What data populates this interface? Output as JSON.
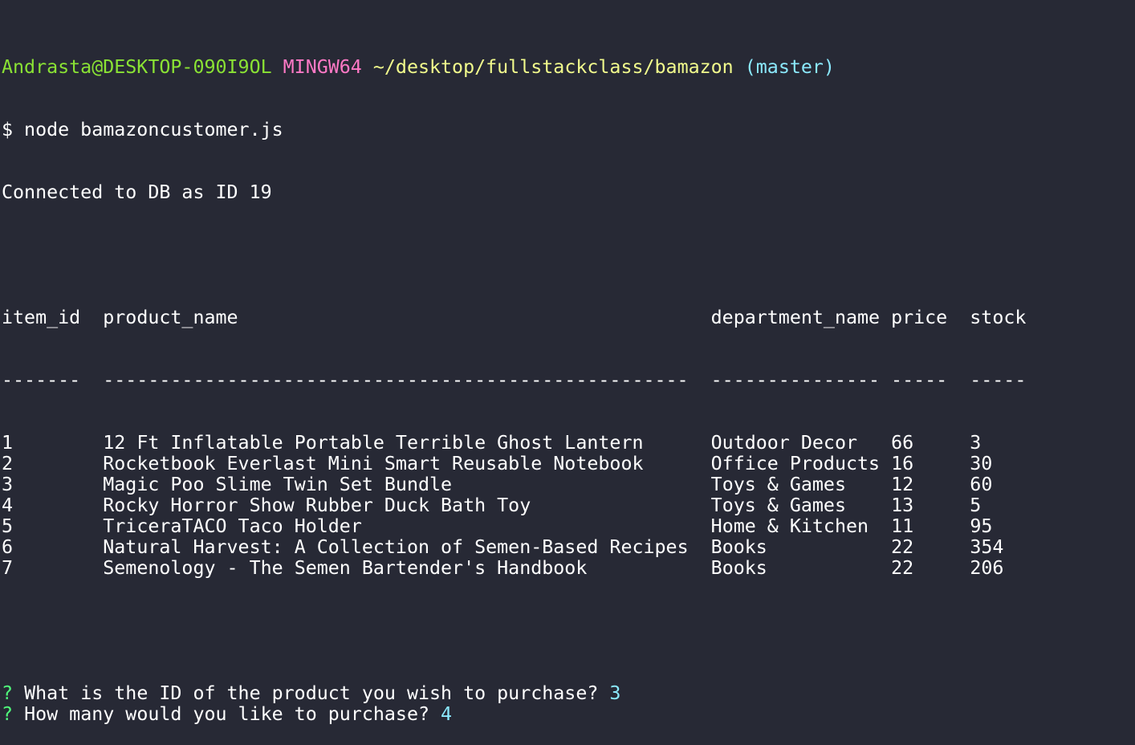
{
  "prompt": {
    "user_host": "Andrasta@DESKTOP-090I9OL",
    "system": "MINGW64",
    "path": "~/desktop/fullstackclass/bamazon",
    "branch": "(master)"
  },
  "command_line": "$ node bamazoncustomer.js",
  "connection_message": "Connected to DB as ID 19",
  "table": {
    "columns": [
      "item_id",
      "product_name",
      "department_name",
      "price",
      "stock"
    ],
    "widths": [
      9,
      54,
      16,
      7,
      5
    ],
    "rows": [
      [
        "1",
        "12 Ft Inflatable Portable Terrible Ghost Lantern",
        "Outdoor Decor",
        "66",
        "3"
      ],
      [
        "2",
        "Rocketbook Everlast Mini Smart Reusable Notebook",
        "Office Products",
        "16",
        "30"
      ],
      [
        "3",
        "Magic Poo Slime Twin Set Bundle",
        "Toys & Games",
        "12",
        "60"
      ],
      [
        "4",
        "Rocky Horror Show Rubber Duck Bath Toy",
        "Toys & Games",
        "13",
        "5"
      ],
      [
        "5",
        "TriceraTACO Taco Holder",
        "Home & Kitchen",
        "11",
        "95"
      ],
      [
        "6",
        "Natural Harvest: A Collection of Semen-Based Recipes",
        "Books",
        "22",
        "354"
      ],
      [
        "7",
        "Semenology - The Semen Bartender's Handbook",
        "Books",
        "22",
        "206"
      ]
    ]
  },
  "questions": [
    {
      "mark": "?",
      "text": "What is the ID of the product you wish to purchase?",
      "answer": "3"
    },
    {
      "mark": "?",
      "text": "How many would you like to purchase?",
      "answer": "4"
    }
  ],
  "colors": {
    "background": "#272935",
    "text": "#ffffff",
    "user_host": "#8ae234",
    "system": "#ff79c6",
    "path": "#f1fa8c",
    "branch": "#8be9fd",
    "question_mark": "#50fa7b",
    "answer": "#8be9fd"
  }
}
